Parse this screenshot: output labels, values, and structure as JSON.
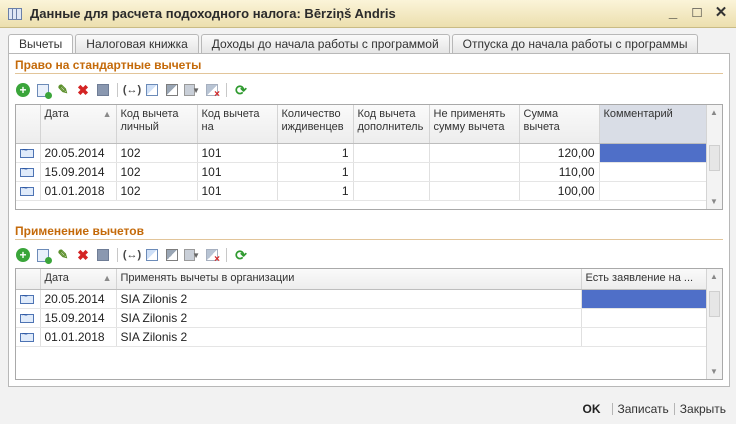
{
  "window": {
    "title": "Данные для расчета подоходного налога: Bērziņš Andris"
  },
  "tabs": [
    {
      "label": "Вычеты",
      "active": true
    },
    {
      "label": "Налоговая книжка"
    },
    {
      "label": "Доходы до начала работы с программой"
    },
    {
      "label": "Отпуска до начала работы с программы"
    }
  ],
  "standard": {
    "title": "Право на стандартные вычеты",
    "columns": [
      "",
      "Дата",
      "Код вычета личный",
      "Код вычета на",
      "Количество иждивенцев",
      "Код вычета дополнитель",
      "Не применять сумму вычета",
      "Сумма вычета",
      "Комментарий"
    ],
    "rows": [
      {
        "date": "20.05.2014",
        "personal": "102",
        "on": "101",
        "dependents": "1",
        "extra": "",
        "noapply": "",
        "sum": "120,00",
        "comment": ""
      },
      {
        "date": "15.09.2014",
        "personal": "102",
        "on": "101",
        "dependents": "1",
        "extra": "",
        "noapply": "",
        "sum": "110,00",
        "comment": ""
      },
      {
        "date": "01.01.2018",
        "personal": "102",
        "on": "101",
        "dependents": "1",
        "extra": "",
        "noapply": "",
        "sum": "100,00",
        "comment": ""
      }
    ]
  },
  "apply": {
    "title": "Применение вычетов",
    "columns": [
      "",
      "Дата",
      "Применять вычеты в организации",
      "Есть заявление на ..."
    ],
    "rows": [
      {
        "date": "20.05.2014",
        "org": "SIA Zilonis 2",
        "statement": ""
      },
      {
        "date": "15.09.2014",
        "org": "SIA Zilonis 2",
        "statement": ""
      },
      {
        "date": "01.01.2018",
        "org": "SIA Zilonis 2",
        "statement": ""
      }
    ]
  },
  "footer": {
    "ok": "OK",
    "save": "Записать",
    "close": "Закрыть"
  },
  "icons": [
    "add-icon",
    "copy-icon",
    "edit-icon",
    "delete-icon",
    "save-icon",
    "brackets-icon",
    "filter-icon",
    "filter-apply-icon",
    "filter-list-icon",
    "clear-filter-icon",
    "refresh-icon"
  ]
}
